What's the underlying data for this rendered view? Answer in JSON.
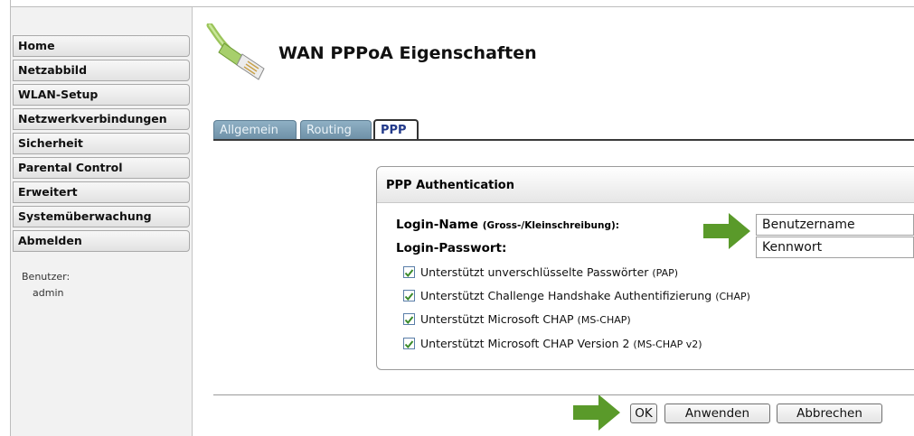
{
  "sidebar": {
    "items": [
      {
        "label": "Home"
      },
      {
        "label": "Netzabbild"
      },
      {
        "label": "WLAN-Setup"
      },
      {
        "label": "Netzwerkverbindungen"
      },
      {
        "label": "Sicherheit"
      },
      {
        "label": "Parental Control"
      },
      {
        "label": "Erweitert"
      },
      {
        "label": "Systemüberwachung"
      },
      {
        "label": "Abmelden"
      }
    ],
    "user_label": "Benutzer:",
    "user_name": "admin"
  },
  "header": {
    "title": "WAN PPPoA Eigenschaften",
    "logo_icon": "ethernet-cable-icon"
  },
  "tabs": [
    {
      "label": "Allgemein",
      "active": false
    },
    {
      "label": "Routing",
      "active": false
    },
    {
      "label": "PPP",
      "active": true
    }
  ],
  "panel": {
    "title": "PPP Authentication",
    "login_name_label": "Login-Name",
    "login_name_hint": "(Gross-/Kleinschreibung):",
    "login_name_value": "Benutzername",
    "login_password_label": "Login-Passwort:",
    "login_password_value": "Kennwort",
    "checkboxes": [
      {
        "label": "Unterstützt unverschlüsselte Passwörter",
        "acronym": "(PAP)",
        "checked": true
      },
      {
        "label": "Unterstützt Challenge Handshake Authentifizierung",
        "acronym": "(CHAP)",
        "checked": true
      },
      {
        "label": "Unterstützt Microsoft CHAP",
        "acronym": "(MS-CHAP)",
        "checked": true
      },
      {
        "label": "Unterstützt Microsoft CHAP Version 2",
        "acronym": "(MS-CHAP v2)",
        "checked": true
      }
    ]
  },
  "buttons": {
    "ok": "OK",
    "apply": "Anwenden",
    "cancel": "Abbrechen"
  },
  "colors": {
    "arrow": "#5a9a2a",
    "tab_inactive": "#7f9fb5",
    "tab_active_text": "#233a8a",
    "check": "#3a8a2a"
  }
}
